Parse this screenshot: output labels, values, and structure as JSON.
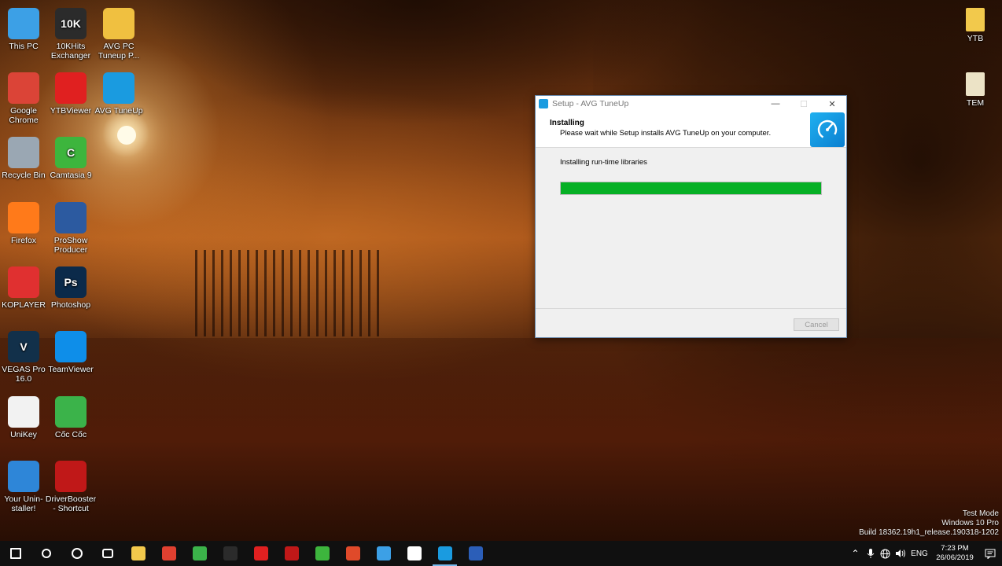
{
  "desktop": {
    "left_icons": [
      {
        "label": "This PC",
        "icon": "this-pc-icon",
        "color": "#3ca0e6"
      },
      {
        "label": "10KHits Exchanger",
        "icon": "10khits-icon",
        "color": "#2b2b2b",
        "glyph": "10K"
      },
      {
        "label": "AVG PC Tuneup P...",
        "icon": "avg-installer-icon",
        "color": "#f0c040"
      },
      {
        "label": "Google Chrome",
        "icon": "chrome-icon",
        "color": "#db4437"
      },
      {
        "label": "YTBViewer",
        "icon": "ytbviewer-icon",
        "color": "#e02020"
      },
      {
        "label": "AVG TuneUp",
        "icon": "avg-tuneup-icon",
        "color": "#1a9be0"
      },
      {
        "label": "Recycle Bin",
        "icon": "recycle-bin-icon",
        "color": "#9aa7b3"
      },
      {
        "label": "Camtasia 9",
        "icon": "camtasia-icon",
        "color": "#3db53d",
        "glyph": "C"
      },
      {
        "label": "Firefox",
        "icon": "firefox-icon",
        "color": "#ff7a1a"
      },
      {
        "label": "ProShow Producer",
        "icon": "proshow-icon",
        "color": "#2c5aa0"
      },
      {
        "label": "KOPLAYER",
        "icon": "koplayer-icon",
        "color": "#e03030"
      },
      {
        "label": "Photoshop",
        "icon": "photoshop-icon",
        "color": "#0b2a4a",
        "glyph": "Ps"
      },
      {
        "label": "VEGAS Pro 16.0",
        "icon": "vegas-icon",
        "color": "#12304a",
        "glyph": "V"
      },
      {
        "label": "TeamViewer",
        "icon": "teamviewer-icon",
        "color": "#0e8ee9"
      },
      {
        "label": "UniKey",
        "icon": "unikey-icon",
        "color": "#f2f2f2"
      },
      {
        "label": "Cốc Cốc",
        "icon": "coccoc-icon",
        "color": "#3bb34a"
      },
      {
        "label": "Your Unin-staller!",
        "icon": "uninstaller-icon",
        "color": "#2e86d8"
      },
      {
        "label": "DriverBooster - Shortcut",
        "icon": "driverbooster-icon",
        "color": "#c01818"
      }
    ],
    "right_icons": [
      {
        "label": "YTB",
        "icon": "folder-icon",
        "color": "#f2c94c"
      },
      {
        "label": "TEM",
        "icon": "folder-icon",
        "color": "#ece3c6"
      }
    ]
  },
  "dialog": {
    "title": "Setup - AVG TuneUp",
    "heading": "Installing",
    "subheading": "Please wait while Setup installs AVG TuneUp on your computer.",
    "status": "Installing run-time libraries",
    "progress": 1.0,
    "cancel_label": "Cancel",
    "minimize_glyph": "—",
    "maximize_glyph": "☐",
    "close_glyph": "✕",
    "accent_color": "#06b025"
  },
  "watermark": {
    "line1": "Test Mode",
    "line2": "Windows 10 Pro",
    "line3": "Build 18362.19h1_release.190318-1202"
  },
  "taskbar": {
    "apps": [
      {
        "name": "start-button",
        "color": "#ffffff"
      },
      {
        "name": "search-button",
        "color": "#ffffff"
      },
      {
        "name": "cortana-button",
        "color": "#ffffff"
      },
      {
        "name": "task-view-button",
        "color": "#ffffff"
      },
      {
        "name": "file-explorer",
        "color": "#f2c94c"
      },
      {
        "name": "app-red-circle",
        "color": "#e04030"
      },
      {
        "name": "coccoc",
        "color": "#3bb34a"
      },
      {
        "name": "10khits",
        "color": "#2b2b2b"
      },
      {
        "name": "ytbviewer",
        "color": "#e02020"
      },
      {
        "name": "driverbooster",
        "color": "#c01818"
      },
      {
        "name": "camtasia",
        "color": "#3db53d"
      },
      {
        "name": "camtasia-recorder",
        "color": "#e04a2a"
      },
      {
        "name": "network-app",
        "color": "#3ca0e6"
      },
      {
        "name": "security-app",
        "color": "#ffffff"
      },
      {
        "name": "avg-tuneup",
        "color": "#1a9be0"
      },
      {
        "name": "word-doc",
        "color": "#2b5eb8"
      }
    ],
    "language": "ENG",
    "time": "7:23 PM",
    "date": "26/06/2019"
  }
}
